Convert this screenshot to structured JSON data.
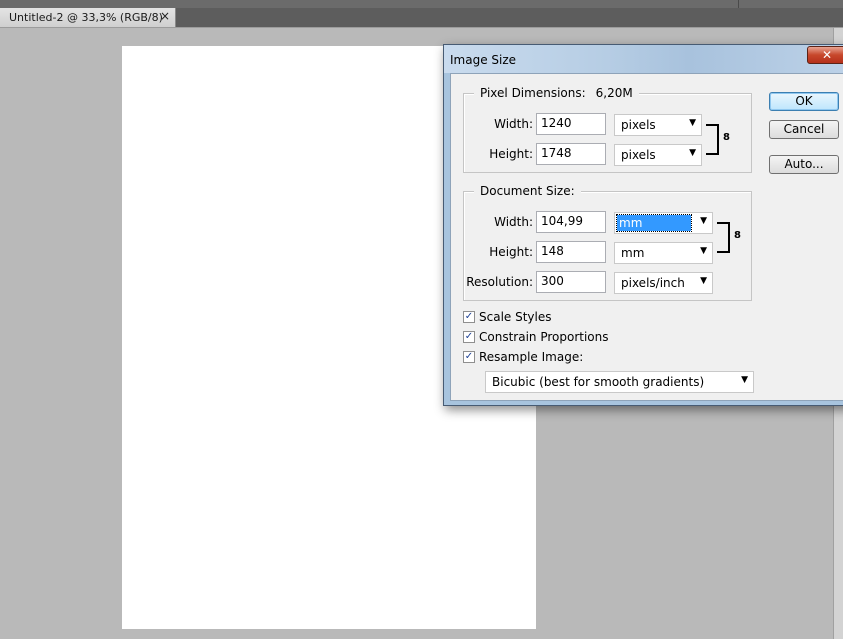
{
  "document_tab": {
    "title": "Untitled-2 @ 33,3% (RGB/8)",
    "close_glyph": "×"
  },
  "dialog": {
    "title": "Image Size",
    "close_glyph": "✕",
    "pixel_dimensions": {
      "label": "Pixel Dimensions:",
      "size": "6,20M",
      "width_label": "Width:",
      "width_value": "1240",
      "width_unit": "pixels",
      "height_label": "Height:",
      "height_value": "1748",
      "height_unit": "pixels"
    },
    "document_size": {
      "label": "Document Size:",
      "width_label": "Width:",
      "width_value": "104,99",
      "width_unit": "mm",
      "height_label": "Height:",
      "height_value": "148",
      "height_unit": "mm",
      "resolution_label": "Resolution:",
      "resolution_value": "300",
      "resolution_unit": "pixels/inch"
    },
    "buttons": {
      "ok": "OK",
      "cancel": "Cancel",
      "auto": "Auto..."
    },
    "checkboxes": {
      "scale_styles": "Scale Styles",
      "constrain_proportions": "Constrain Proportions",
      "resample_image": "Resample Image:",
      "scale_styles_checked": true,
      "constrain_proportions_checked": true,
      "resample_image_checked": true,
      "check_glyph": "✓"
    },
    "resample_method": "Bicubic (best for smooth gradients)",
    "dropdown_glyph": "▼",
    "link_glyph": "8"
  },
  "colors": {
    "workspace": "#b9b9b9",
    "document": "#ffffff",
    "dialog_face": "#f0f0f0",
    "close_button": "#c7472b",
    "selection": "#3399ff"
  }
}
